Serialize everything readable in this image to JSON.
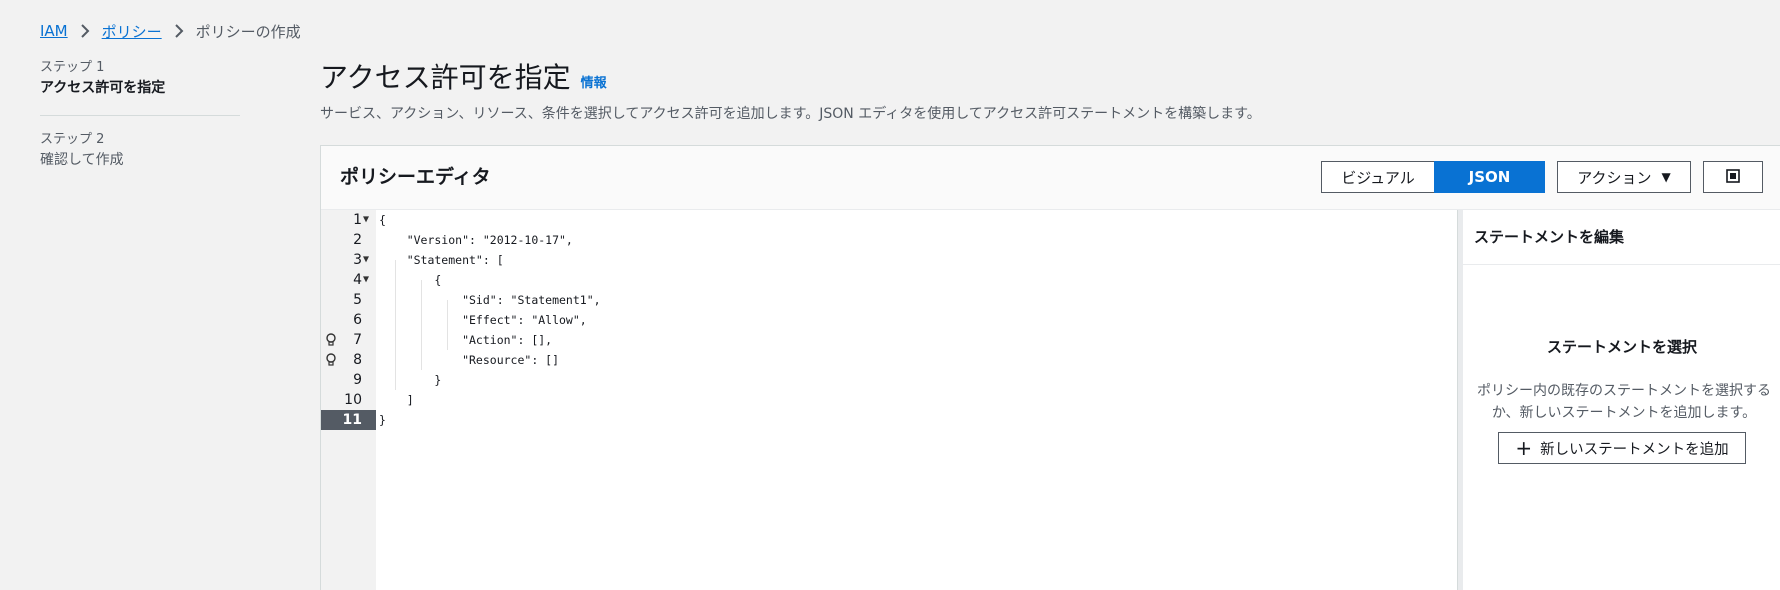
{
  "breadcrumb": {
    "items": [
      "IAM",
      "ポリシー",
      "ポリシーの作成"
    ]
  },
  "steps": [
    {
      "num": "ステップ 1",
      "title": "アクセス許可を指定"
    },
    {
      "num": "ステップ 2",
      "title": "確認して作成"
    }
  ],
  "header": {
    "title": "アクセス許可を指定",
    "info": "情報",
    "description": "サービス、アクション、リソース、条件を選択してアクセス許可を追加します。JSON エディタを使用してアクセス許可ステートメントを構築します。"
  },
  "editor": {
    "title": "ポリシーエディタ",
    "visual_label": "ビジュアル",
    "json_label": "JSON",
    "actions_label": "アクション",
    "code_lines": [
      "{",
      "    \"Version\": \"2012-10-17\",",
      "    \"Statement\": [",
      "        {",
      "            \"Sid\": \"Statement1\",",
      "            \"Effect\": \"Allow\",",
      "            \"Action\": [],",
      "            \"Resource\": []",
      "        }",
      "    ]",
      "}"
    ],
    "line_numbers": [
      "1",
      "2",
      "3",
      "4",
      "5",
      "6",
      "7",
      "8",
      "9",
      "10",
      "11"
    ]
  },
  "side_panel": {
    "title": "ステートメントを編集",
    "empty_title": "ステートメントを選択",
    "empty_desc": "ポリシー内の既存のステートメントを選択するか、新しいステートメントを追加します。",
    "add_label": "新しいステートメントを追加"
  },
  "colors": {
    "accent": "#0972d3",
    "active_line": "#545b64"
  }
}
